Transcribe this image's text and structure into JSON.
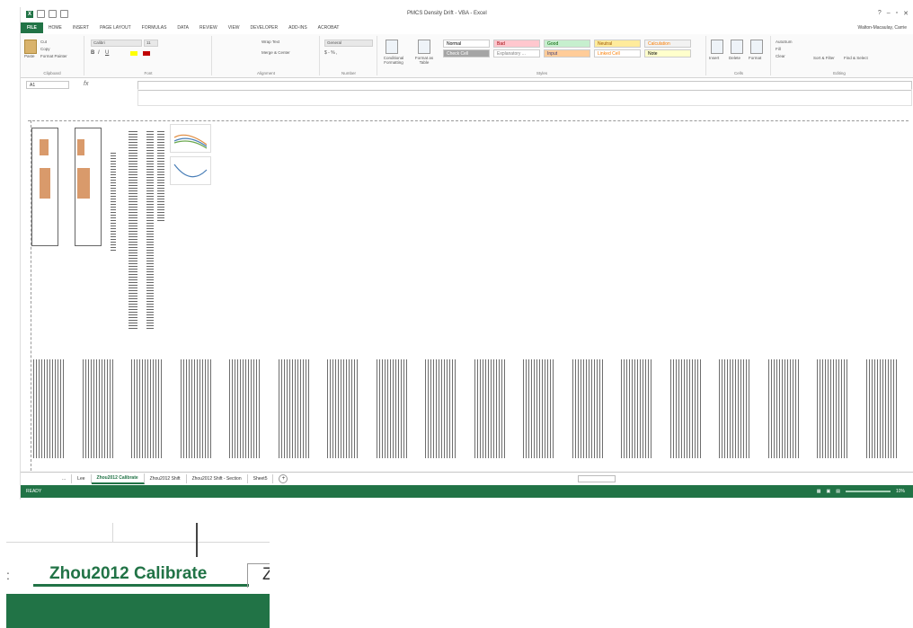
{
  "window": {
    "title": "PMCS Density Drift - VBA - Excel",
    "user": "Walton-Macaulay, Carrie"
  },
  "ribbon": {
    "tabs": [
      "FILE",
      "HOME",
      "INSERT",
      "PAGE LAYOUT",
      "FORMULAS",
      "DATA",
      "REVIEW",
      "VIEW",
      "DEVELOPER",
      "ADD-INS",
      "ACROBAT"
    ],
    "clipboard": {
      "paste": "Paste",
      "cut": "Cut",
      "copy": "Copy",
      "format_painter": "Format Painter",
      "label": "Clipboard"
    },
    "font": {
      "name": "Calibri",
      "size": "11",
      "label": "Font"
    },
    "alignment": {
      "wrap": "Wrap Text",
      "merge": "Merge & Center",
      "label": "Alignment"
    },
    "number": {
      "format": "General",
      "label": "Number"
    },
    "styles": {
      "conditional": "Conditional Formatting",
      "format_table": "Format as Table",
      "cells": [
        {
          "name": "Normal",
          "bg": "#ffffff",
          "fg": "#000000"
        },
        {
          "name": "Bad",
          "bg": "#ffc7ce",
          "fg": "#9c0006"
        },
        {
          "name": "Good",
          "bg": "#c6efce",
          "fg": "#006100"
        },
        {
          "name": "Neutral",
          "bg": "#ffeb9c",
          "fg": "#9c5700"
        },
        {
          "name": "Calculation",
          "bg": "#f2f2f2",
          "fg": "#fa7d00"
        },
        {
          "name": "Check Cell",
          "bg": "#a5a5a5",
          "fg": "#ffffff"
        },
        {
          "name": "Explanatory ...",
          "bg": "#ffffff",
          "fg": "#7f7f7f"
        },
        {
          "name": "Input",
          "bg": "#ffcc99",
          "fg": "#3f3f76"
        },
        {
          "name": "Linked Cell",
          "bg": "#ffffff",
          "fg": "#fa7d00"
        },
        {
          "name": "Note",
          "bg": "#ffffcc",
          "fg": "#000000"
        }
      ],
      "label": "Styles"
    },
    "cells_group": {
      "insert": "Insert",
      "delete": "Delete",
      "format": "Format",
      "label": "Cells"
    },
    "editing": {
      "autosum": "AutoSum",
      "fill": "Fill",
      "clear": "Clear",
      "sort": "Sort & Filter",
      "find": "Find & Select",
      "label": "Editing"
    }
  },
  "formula_bar": {
    "name_box": "A1",
    "fx": "fx",
    "formula": ""
  },
  "sheet_tabs": {
    "prev": "...",
    "tabs": [
      "Lee",
      "Zhou2012 Calibrate",
      "Zhou2012 Shift",
      "Zhou2012 Shift - Section",
      "Sheet5"
    ],
    "active": "Zhou2012 Calibrate",
    "add": "+"
  },
  "status": {
    "ready": "READY",
    "zoom": "10%"
  },
  "inset": {
    "active_tab": "Zhou2012 Calibrate",
    "next_tab_fragment": "Z",
    "prev_mark": ":"
  },
  "colors": {
    "excel_green": "#217346"
  }
}
